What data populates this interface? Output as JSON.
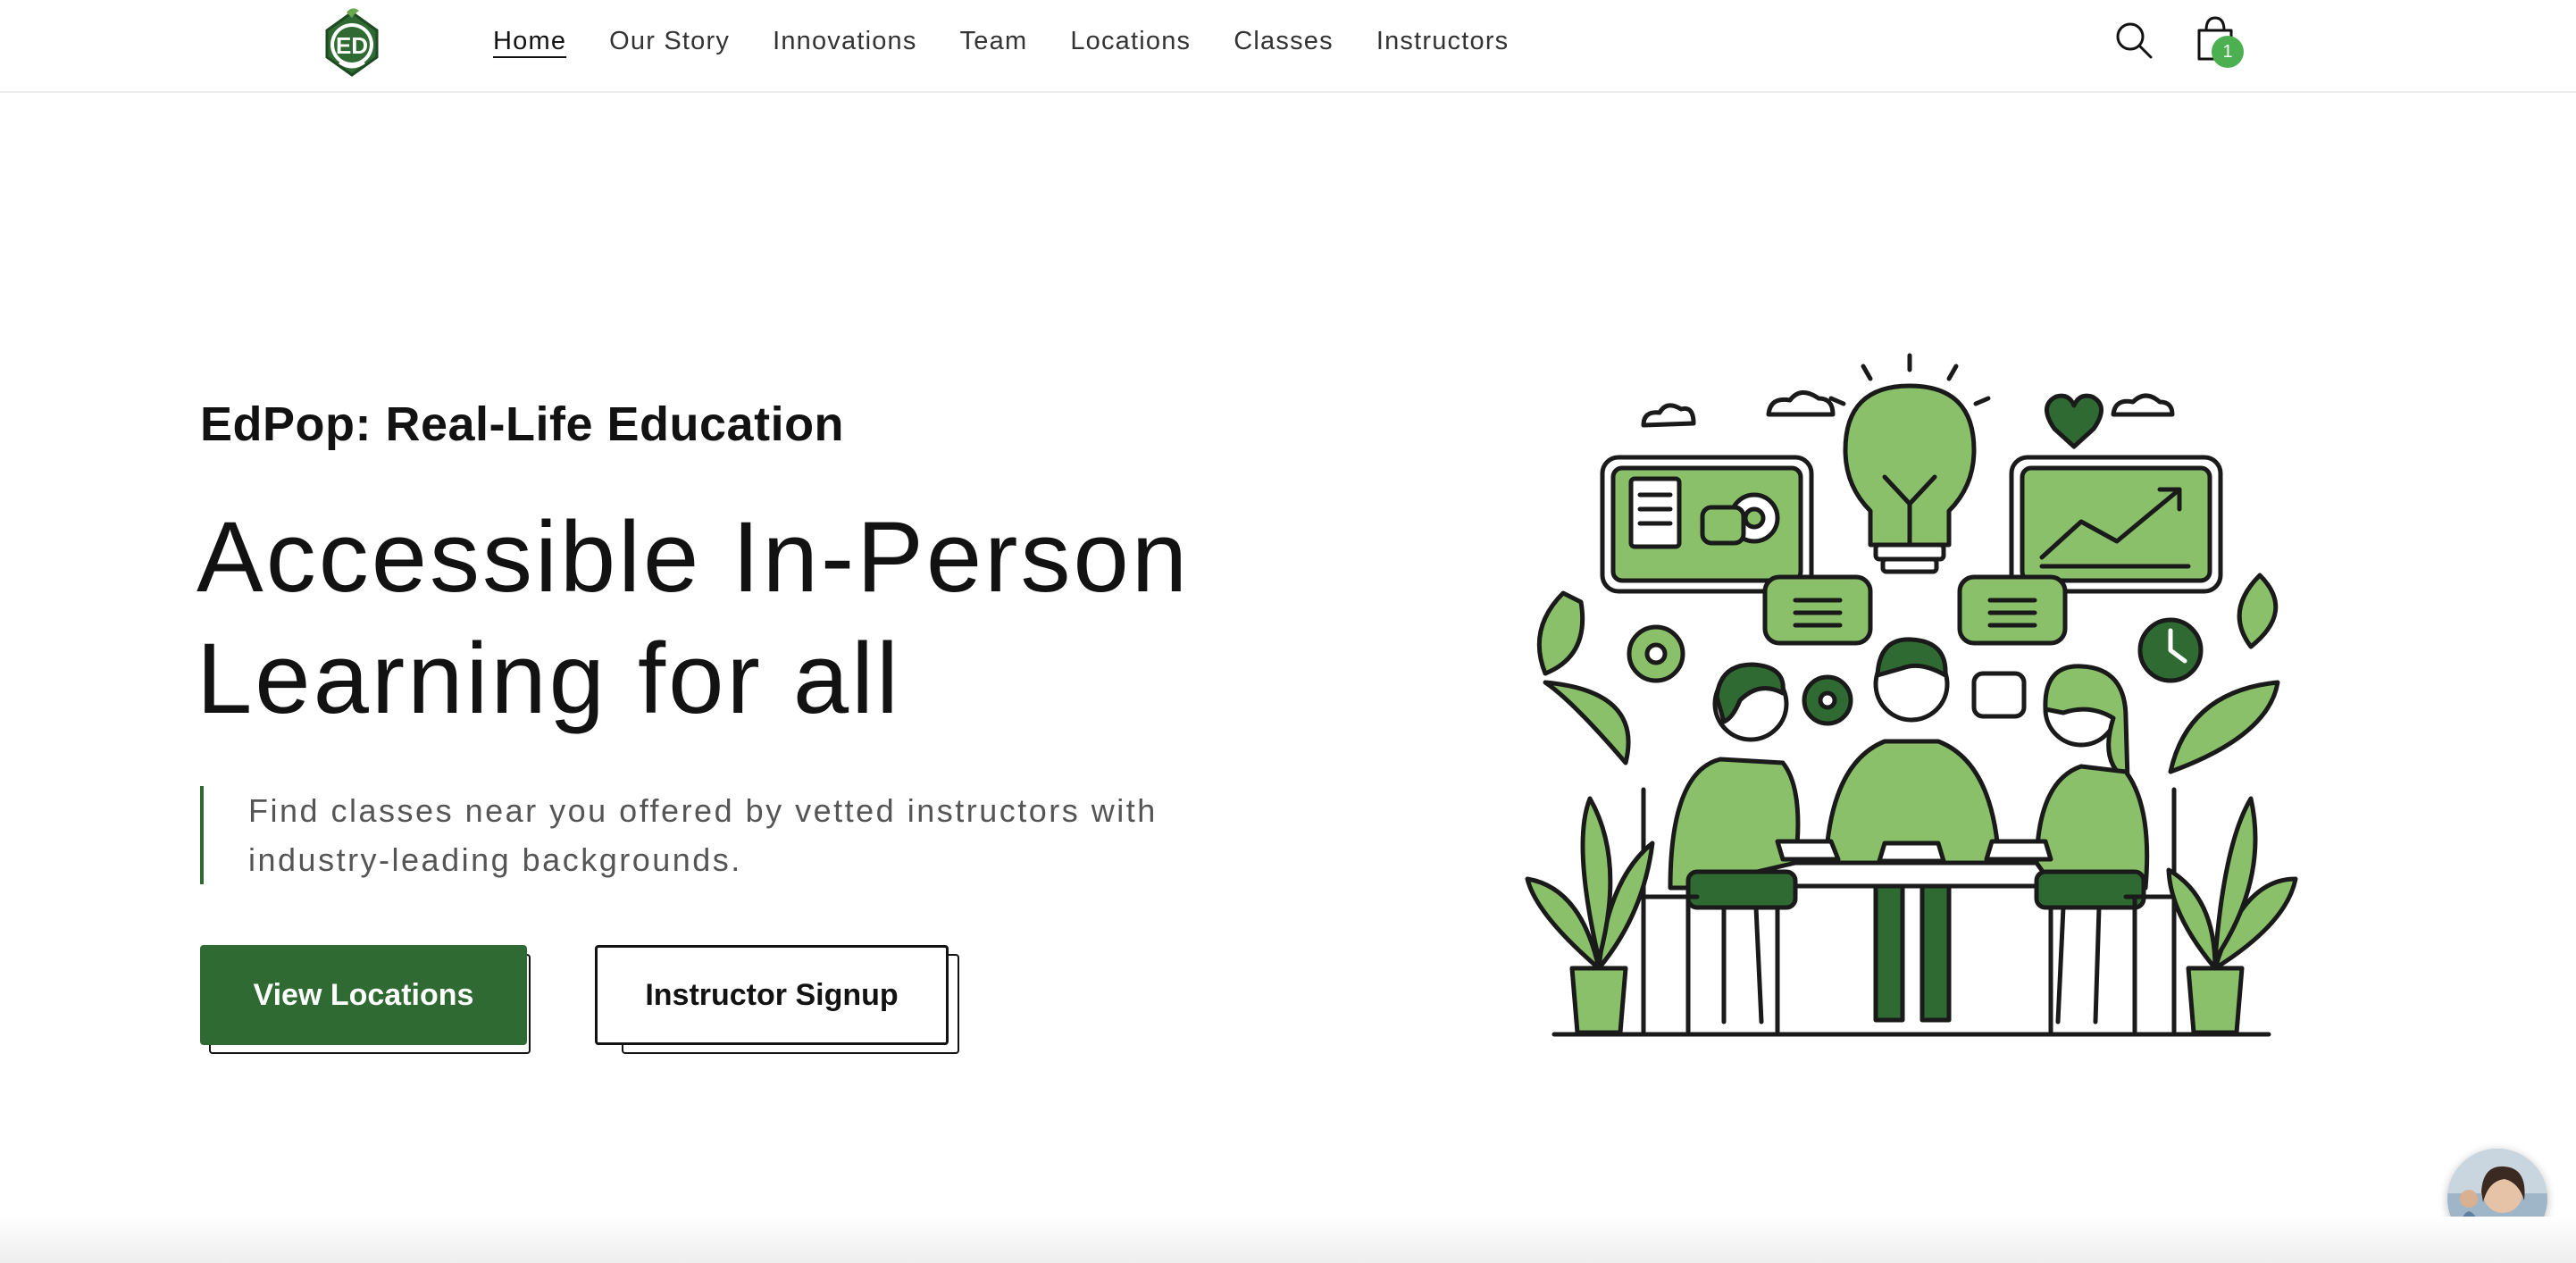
{
  "brand": {
    "logo_text": "ED",
    "logo_color": "#2f6a33"
  },
  "nav": {
    "items": [
      {
        "label": "Home",
        "active": true
      },
      {
        "label": "Our Story"
      },
      {
        "label": "Innovations"
      },
      {
        "label": "Team"
      },
      {
        "label": "Locations"
      },
      {
        "label": "Classes"
      },
      {
        "label": "Instructors"
      }
    ]
  },
  "header_icons": {
    "search": "search-icon",
    "cart": "shopping-bag-icon",
    "cart_count": "1"
  },
  "hero": {
    "eyebrow": "EdPop: Real-Life Education",
    "headline": "Accessible In-Person Learning for all",
    "description": "Find classes near you offered by vetted instructors with industry-leading backgrounds.",
    "primary_button": "View Locations",
    "secondary_button": "Instructor Signup"
  },
  "colors": {
    "accent": "#2f6a33",
    "illustration_green": "#8bc06a",
    "badge": "#4caf50"
  }
}
